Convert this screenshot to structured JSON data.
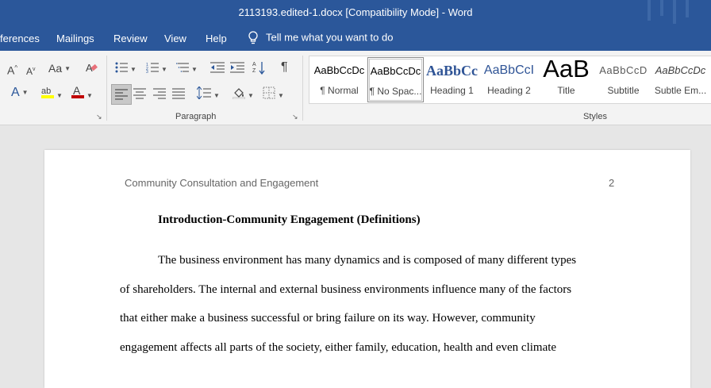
{
  "window": {
    "title": "2113193.edited-1.docx [Compatibility Mode]  -  Word"
  },
  "menu": {
    "items": [
      "ferences",
      "Mailings",
      "Review",
      "View",
      "Help"
    ],
    "tell_me": "Tell me what you want to do"
  },
  "ribbon": {
    "font_group": {
      "grow_font": "A",
      "shrink_font": "A",
      "change_case": "Aa",
      "text_effects": "A",
      "highlight": "ab",
      "font_color": "A"
    },
    "paragraph_group": {
      "label": "Paragraph",
      "show_marks": "¶"
    },
    "styles_group": {
      "label": "Styles",
      "items": [
        {
          "sample": "AaBbCcDc",
          "name": "¶ Normal"
        },
        {
          "sample": "AaBbCcDc",
          "name": "¶ No Spac..."
        },
        {
          "sample": "AaBbCc",
          "name": "Heading 1"
        },
        {
          "sample": "AaBbCcI",
          "name": "Heading 2"
        },
        {
          "sample": "AaB",
          "name": "Title"
        },
        {
          "sample": "AaBbCcD",
          "name": "Subtitle"
        },
        {
          "sample": "AaBbCcDc",
          "name": "Subtle Em..."
        }
      ]
    },
    "colors": {
      "highlight_bar": "#ffff00",
      "font_color_bar": "#c00000"
    }
  },
  "document": {
    "header_text": "Community Consultation and Engagement",
    "page_number": "2",
    "heading": "Introduction-Community Engagement (Definitions)",
    "lines": [
      "The business environment has many dynamics and is composed of many different types",
      "of shareholders. The internal and external business environments influence many of the factors",
      "that either make a business successful or bring failure on its way. However, community",
      "engagement affects all parts of the society, either family, education, health and even climate"
    ]
  },
  "colors": {
    "titlebar": "#2b579a",
    "ribbon": "#f3f3f3",
    "canvas": "#e6e6e6"
  }
}
